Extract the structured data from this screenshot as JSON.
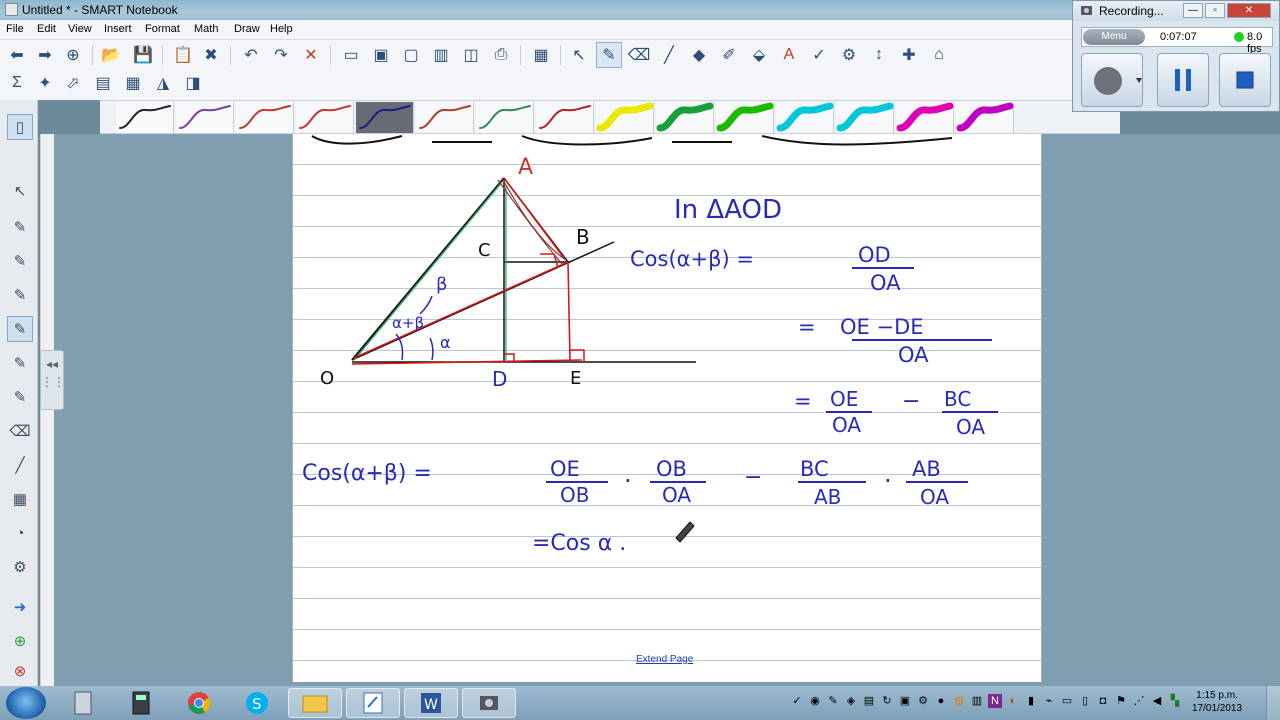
{
  "window": {
    "title": "Untitled * - SMART Notebook"
  },
  "menu": [
    "File",
    "Edit",
    "View",
    "Insert",
    "Format",
    "Math",
    "Draw",
    "Help"
  ],
  "pens": [
    "#222222",
    "#7a3fa0",
    "#c0392b",
    "#c0392b",
    "#1a1a8c",
    "#b03a2e",
    "#2e8b57",
    "#b22222",
    "#e8e800",
    "#1a9e3a",
    "#1db800",
    "#00c8d8",
    "#00c8d8",
    "#e000b0",
    "#c000c0"
  ],
  "diagram": {
    "labels": {
      "A": "A",
      "B": "B",
      "C": "C",
      "O": "O",
      "D": "D",
      "E": "E",
      "beta": "β",
      "alpha_beta": "α+β",
      "alpha": "α"
    }
  },
  "notes": {
    "triangle": "In ΔAOD",
    "cos_sum": "Cos(α+β) =",
    "od": "OD",
    "oa1": "OA",
    "eq2": "=",
    "oe_de": "OE −DE",
    "oa2": "OA",
    "eq3": "=",
    "oe": "OE",
    "minus": "−",
    "bc": "BC",
    "oa3": "OA",
    "oa4": "OA",
    "cos_sum2": "Cos(α+β) =",
    "oe2": "OE",
    "ob": "OB",
    "dot1": ".",
    "ob2": "OB",
    "oa5": "OA",
    "minus2": "−",
    "bc2": "BC",
    "ab": "AB",
    "dot2": ".",
    "ab2": "AB",
    "oa6": "OA",
    "final": "=Cos α ."
  },
  "extend_page": "Extend Page",
  "recording": {
    "title": "Recording...",
    "menu": "Menu",
    "time": "0:07:07",
    "fps": "8.0 fps"
  },
  "clock": {
    "time": "1:15 p.m.",
    "date": "17/01/2013"
  }
}
